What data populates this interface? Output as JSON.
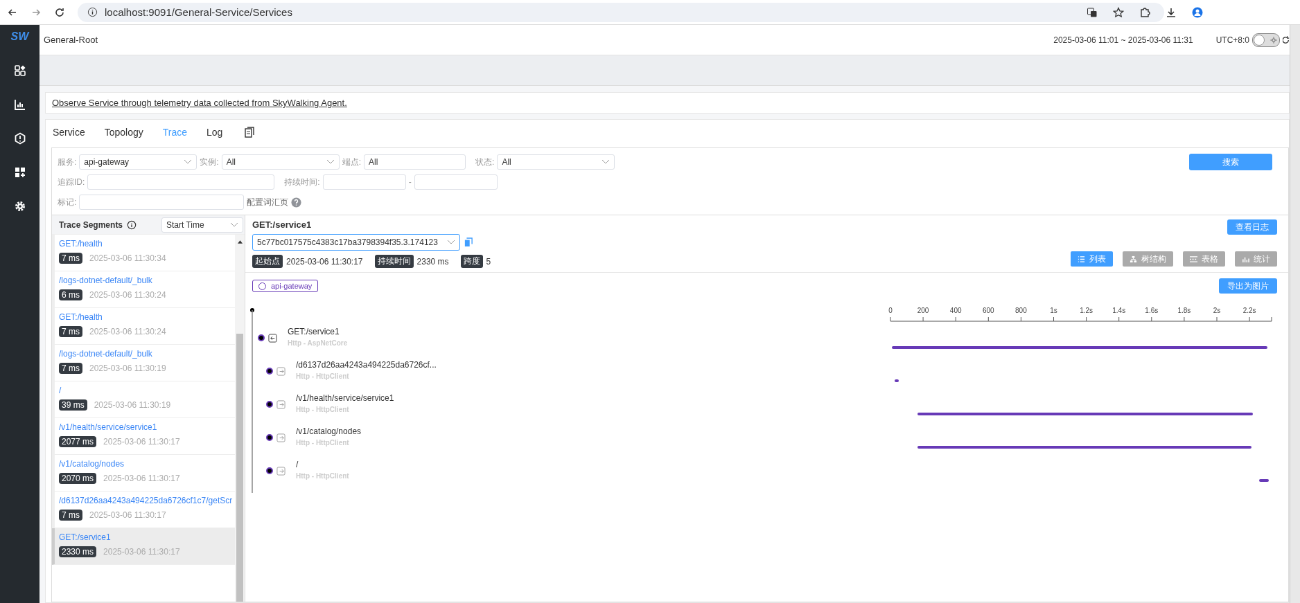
{
  "browser": {
    "url": "localhost:9091/General-Service/Services"
  },
  "nav": {
    "logo": "SW"
  },
  "header": {
    "title": "General-Root",
    "time_range": "2025-03-06 11:01 ~ 2025-03-06 11:31",
    "timezone": "UTC+8:0",
    "dark_mode": {
      "on": false
    }
  },
  "description": "Observe Service through telemetry data collected from SkyWalking Agent.",
  "tabs": [
    {
      "label": "Service",
      "selected": false
    },
    {
      "label": "Topology",
      "selected": false
    },
    {
      "label": "Trace",
      "selected": true
    },
    {
      "label": "Log",
      "selected": false
    }
  ],
  "filters": {
    "service": {
      "label": "服务:",
      "value": "api-gateway"
    },
    "instance": {
      "label": "实例:",
      "value": "All"
    },
    "endpoint": {
      "label": "端点:",
      "value": "All"
    },
    "status": {
      "label": "状态:",
      "value": "All"
    },
    "trace_id": {
      "label": "追踪ID:"
    },
    "duration": {
      "label": "持续时间:",
      "separator": "-"
    },
    "tags": {
      "label": "标记:"
    },
    "tag_help": "配置词汇页",
    "search_button": "搜索"
  },
  "segments": {
    "title": "Trace Segments",
    "sort": "Start Time",
    "items": [
      {
        "title": "GET:/health",
        "duration": "7 ms",
        "time": "2025-03-06 11:30:34",
        "selected": false
      },
      {
        "title": "/logs-dotnet-default/_bulk",
        "duration": "6 ms",
        "time": "2025-03-06 11:30:24",
        "selected": false
      },
      {
        "title": "GET:/health",
        "duration": "7 ms",
        "time": "2025-03-06 11:30:24",
        "selected": false
      },
      {
        "title": "/logs-dotnet-default/_bulk",
        "duration": "7 ms",
        "time": "2025-03-06 11:30:19",
        "selected": false
      },
      {
        "title": "/",
        "duration": "39 ms",
        "time": "2025-03-06 11:30:19",
        "selected": false
      },
      {
        "title": "/v1/health/service/service1",
        "duration": "2077 ms",
        "time": "2025-03-06 11:30:17",
        "selected": false
      },
      {
        "title": "/v1/catalog/nodes",
        "duration": "2070 ms",
        "time": "2025-03-06 11:30:17",
        "selected": false
      },
      {
        "title": "/d6137d26aa4243a494225da6726cf1c7/getScr",
        "duration": "7 ms",
        "time": "2025-03-06 11:30:17",
        "selected": false
      },
      {
        "title": "GET:/service1",
        "duration": "2330 ms",
        "time": "2025-03-06 11:30:17",
        "selected": true
      }
    ]
  },
  "trace": {
    "title": "GET:/service1",
    "trace_id": "5c77bc017575c4383c17ba3798394f35.3.174123",
    "logs_button": "查看日志",
    "meta": [
      {
        "label": "起始点",
        "value": "2025-03-06 11:30:17"
      },
      {
        "label": "持续时间",
        "value": "2330 ms"
      },
      {
        "label": "跨度",
        "value": "5"
      }
    ],
    "views": [
      {
        "label": "列表",
        "kind": "list",
        "selected": true
      },
      {
        "label": "树结构",
        "kind": "tree",
        "selected": false
      },
      {
        "label": "表格",
        "kind": "table",
        "selected": false
      },
      {
        "label": "统计",
        "kind": "stats",
        "selected": false
      }
    ],
    "service_tag": "api-gateway",
    "export_button": "导出为图片",
    "spans": [
      {
        "name": "GET:/service1",
        "component": "Http - AspNetCore",
        "kind": "entry",
        "children": [
          {
            "name": "/d6137d26aa4243a494225da6726cf...",
            "component": "Http - HttpClient",
            "kind": "exit"
          },
          {
            "name": "/v1/health/service/service1",
            "component": "Http - HttpClient",
            "kind": "exit"
          },
          {
            "name": "/v1/catalog/nodes",
            "component": "Http - HttpClient",
            "kind": "exit"
          },
          {
            "name": "/",
            "component": "Http - HttpClient",
            "kind": "exit"
          }
        ]
      }
    ],
    "timeline_ticks": [
      "0",
      "200",
      "400",
      "600",
      "800",
      "1s",
      "1.2s",
      "1.4s",
      "1.6s",
      "1.8s",
      "2s",
      "2.2s"
    ]
  }
}
